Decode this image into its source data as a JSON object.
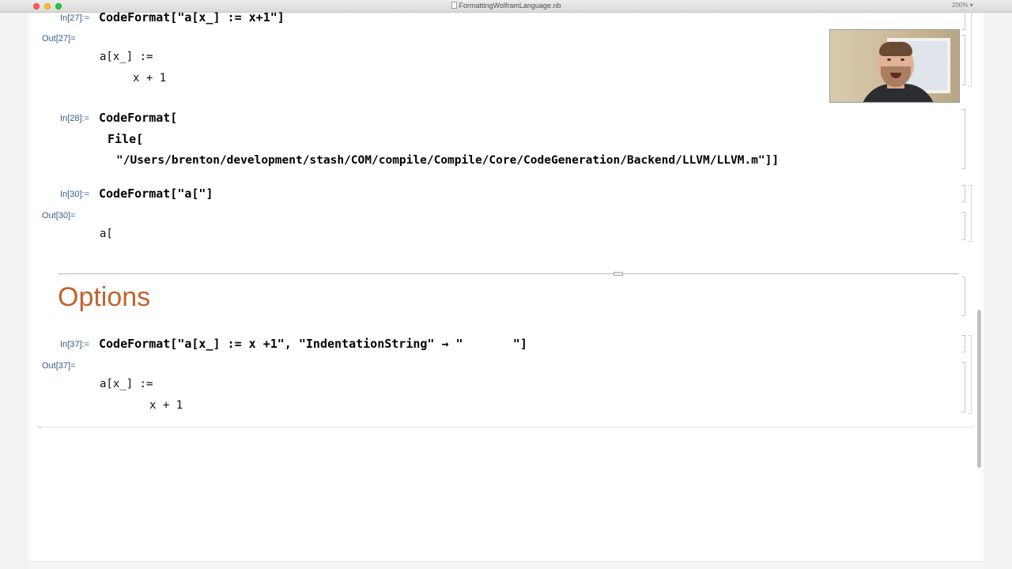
{
  "window": {
    "title": "FormattingWolframLanguage.nb",
    "zoom": "200%"
  },
  "cells": {
    "in27": {
      "label": "In[27]:=",
      "code": "CodeFormat[\"a[x_] := x+1\"]"
    },
    "out27": {
      "label": "Out[27]=",
      "line1": "a[x_] :=",
      "line2": "x + 1"
    },
    "in28": {
      "label": "In[28]:=",
      "line1": "CodeFormat[",
      "line2": "File[",
      "line3": "\"/Users/brenton/development/stash/COM/compile/Compile/Core/CodeGeneration/Backend/LLVM/LLVM.m\"]]"
    },
    "in30": {
      "label": "In[30]:=",
      "code": "CodeFormat[\"a[\"]"
    },
    "out30": {
      "label": "Out[30]=",
      "line1": "a["
    },
    "section": {
      "title": "Options"
    },
    "in37": {
      "label": "In[37]:=",
      "code": "CodeFormat[\"a[x_] := x +1\", \"IndentationString\" → \"       \"]"
    },
    "out37": {
      "label": "Out[37]=",
      "line1": "a[x_] :=",
      "line2": "x + 1"
    }
  },
  "webcam": {
    "icon": "webcam-video-feed"
  },
  "colors": {
    "label_blue": "#335c8f",
    "section_orange": "#c3622b"
  }
}
